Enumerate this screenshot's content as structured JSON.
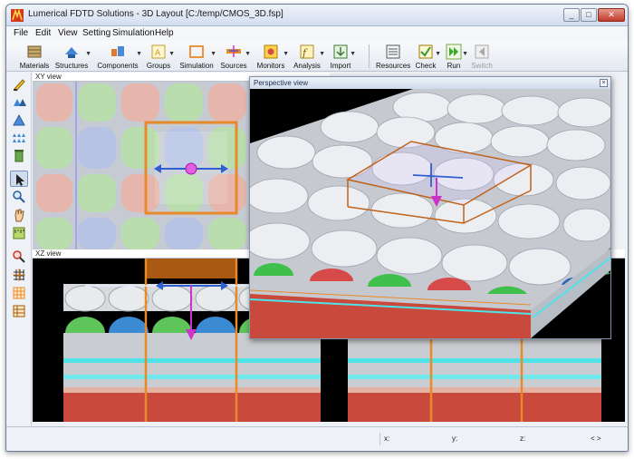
{
  "window": {
    "title": "Lumerical FDTD Solutions - 3D Layout [C:/temp/CMOS_3D.fsp]",
    "controls": [
      "_",
      "□",
      "✕"
    ]
  },
  "menubar": {
    "items": [
      "File",
      "Edit",
      "View",
      "Setting",
      "Simulation",
      "Help"
    ]
  },
  "toolbar": {
    "buttons": [
      {
        "label": "Materials",
        "icon": "materials-icon"
      },
      {
        "label": "Structures",
        "icon": "structures-icon"
      },
      {
        "label": "Components",
        "icon": "components-icon"
      },
      {
        "label": "Groups",
        "icon": "groups-icon"
      },
      {
        "label": "Simulation",
        "icon": "simulation-icon"
      },
      {
        "label": "Sources",
        "icon": "sources-icon"
      },
      {
        "label": "Monitors",
        "icon": "monitors-icon"
      },
      {
        "label": "Analysis",
        "icon": "analysis-icon"
      },
      {
        "label": "Import",
        "icon": "import-icon"
      },
      {
        "label": "Resources",
        "icon": "resources-icon"
      },
      {
        "label": "Check",
        "icon": "check-icon"
      },
      {
        "label": "Run",
        "icon": "run-icon"
      },
      {
        "label": "Switch",
        "icon": "switch-icon",
        "disabled": true
      }
    ]
  },
  "sidebar": {
    "tools": [
      "draw-icon",
      "rotate-icon",
      "pan-icon",
      "zoom-tool-icon",
      "delete-icon",
      "select-arrow-icon",
      "magnify-icon",
      "hand-icon",
      "ruler-icon",
      "zoom-extent-icon",
      "grid-icon",
      "mesh-icon",
      "table-icon"
    ]
  },
  "views": {
    "xy_label": "XY view",
    "xz_label": "XZ view",
    "perspective_label": "Perspective view"
  },
  "statusbar": {
    "x_label": "x:",
    "y_label": "y:",
    "z_label": "z:",
    "nav": "< >"
  },
  "colors": {
    "accent": "#e88a2a",
    "pixel_red": "#d64a4a",
    "pixel_green": "#3fbf4c",
    "pixel_blue": "#3a6fd1",
    "source_arrow": "#2f5fd0",
    "magenta": "#cc33cc"
  }
}
